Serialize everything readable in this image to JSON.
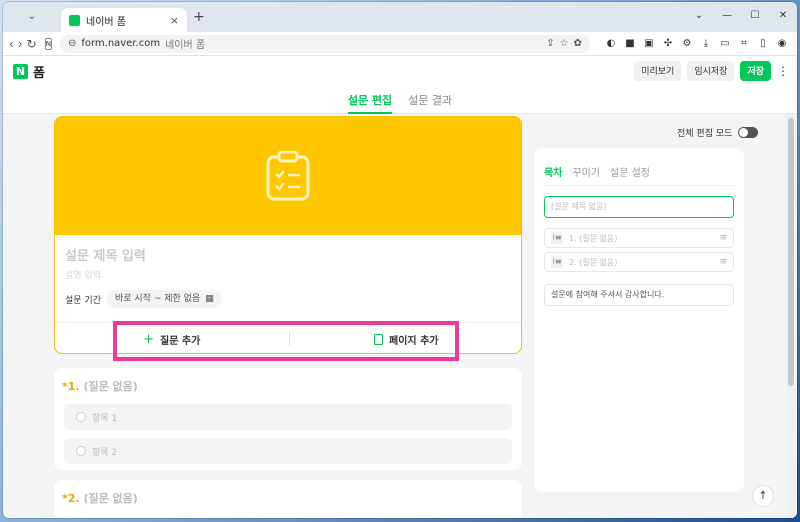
{
  "browser": {
    "tab_title": "네이버 폼",
    "url": "form.naver.com",
    "page_title": "네이버 폼"
  },
  "app": {
    "logo_letter": "N",
    "logo_text": "폼",
    "preview_label": "미리보기",
    "draft_label": "임시저장",
    "save_label": "저장"
  },
  "editor_tabs": [
    "설문 편집",
    "설문 결과"
  ],
  "main": {
    "title_placeholder": "설문 제목 입력",
    "desc_placeholder": "설명 입력",
    "period_label": "설문 기간",
    "period_value": "바로 시작 ~ 제한 없음",
    "add_question_label": "질문 추가",
    "add_page_label": "페이지 추가",
    "accent_color": "#ffc700",
    "highlight_color": "#ec3a9b"
  },
  "questions": [
    {
      "number": "1.",
      "title": "(질문 없음)",
      "options": [
        "항목 1",
        "항목 2"
      ]
    },
    {
      "number": "2.",
      "title": "(질문 없음)",
      "options": []
    }
  ],
  "side": {
    "edit_mode_label": "전체 편집 모드",
    "tabs": [
      "목차",
      "꾸미기",
      "설문 설정"
    ],
    "title_placeholder": "(설문 제목 없음)",
    "items": [
      "1. (질문 없음)",
      "2. (질문 없음)"
    ],
    "end_message": "설문에 참여해 주셔서 감사합니다."
  }
}
